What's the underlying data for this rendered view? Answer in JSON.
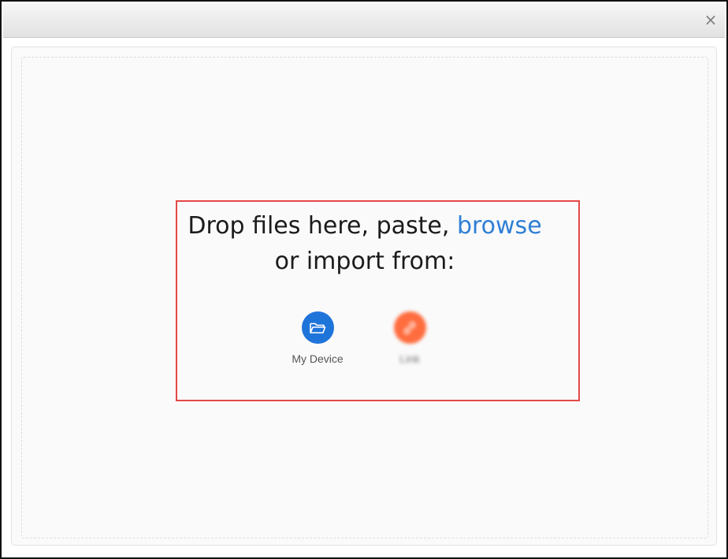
{
  "window": {
    "close_glyph": "×"
  },
  "dropzone": {
    "title_part1": "Drop files here, paste,",
    "browse_label": "browse",
    "title_part2": "or import from:"
  },
  "providers": [
    {
      "label": "My Device",
      "icon": "folder-open-icon",
      "color": "#1f74da"
    },
    {
      "label": "Link",
      "icon": "link-icon",
      "color": "#ff6d3f"
    }
  ],
  "colors": {
    "accent": "#2f7fd6",
    "highlight_border": "#e54848"
  }
}
